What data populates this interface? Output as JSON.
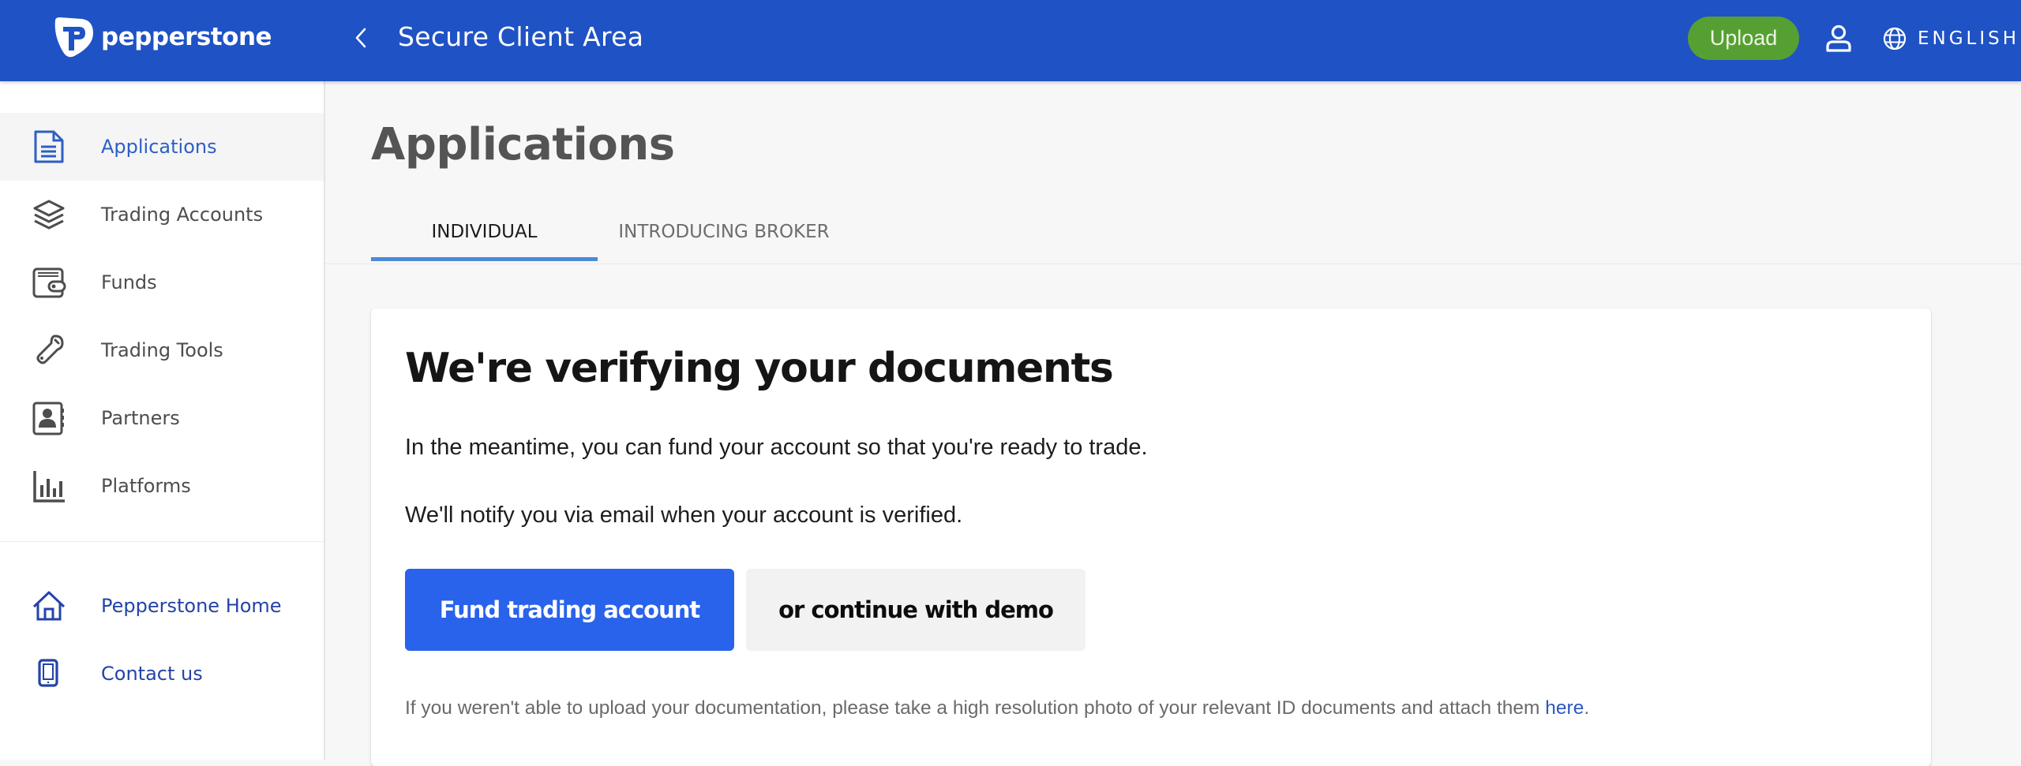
{
  "header": {
    "brand": "pepperstone",
    "title": "Secure Client Area",
    "upload_label": "Upload",
    "language_label": "ENGLISH",
    "colors": {
      "bar": "#1f52c4",
      "upload": "#56a033"
    }
  },
  "sidebar": {
    "items": [
      {
        "label": "Applications",
        "icon": "document-icon",
        "active": true
      },
      {
        "label": "Trading Accounts",
        "icon": "layers-icon"
      },
      {
        "label": "Funds",
        "icon": "wallet-icon"
      },
      {
        "label": "Trading Tools",
        "icon": "wrench-icon"
      },
      {
        "label": "Partners",
        "icon": "contact-book-icon"
      },
      {
        "label": "Platforms",
        "icon": "bar-chart-icon"
      }
    ],
    "links": [
      {
        "label": "Pepperstone Home",
        "icon": "home-icon"
      },
      {
        "label": "Contact us",
        "icon": "phone-icon"
      }
    ]
  },
  "main": {
    "title": "Applications",
    "tabs": [
      {
        "label": "INDIVIDUAL",
        "active": true
      },
      {
        "label": "INTRODUCING BROKER",
        "active": false
      }
    ],
    "card": {
      "heading": "We're verifying your documents",
      "paragraph1": "In the meantime, you can fund your account so that you're ready to trade.",
      "paragraph2": "We'll notify you via email when your account is verified.",
      "primary_button": "Fund trading account",
      "secondary_button": "or continue with demo",
      "note_text": "If you weren't able to upload your documentation, please take a high resolution photo of your relevant ID documents and attach them ",
      "note_link": "here",
      "note_end": "."
    }
  }
}
